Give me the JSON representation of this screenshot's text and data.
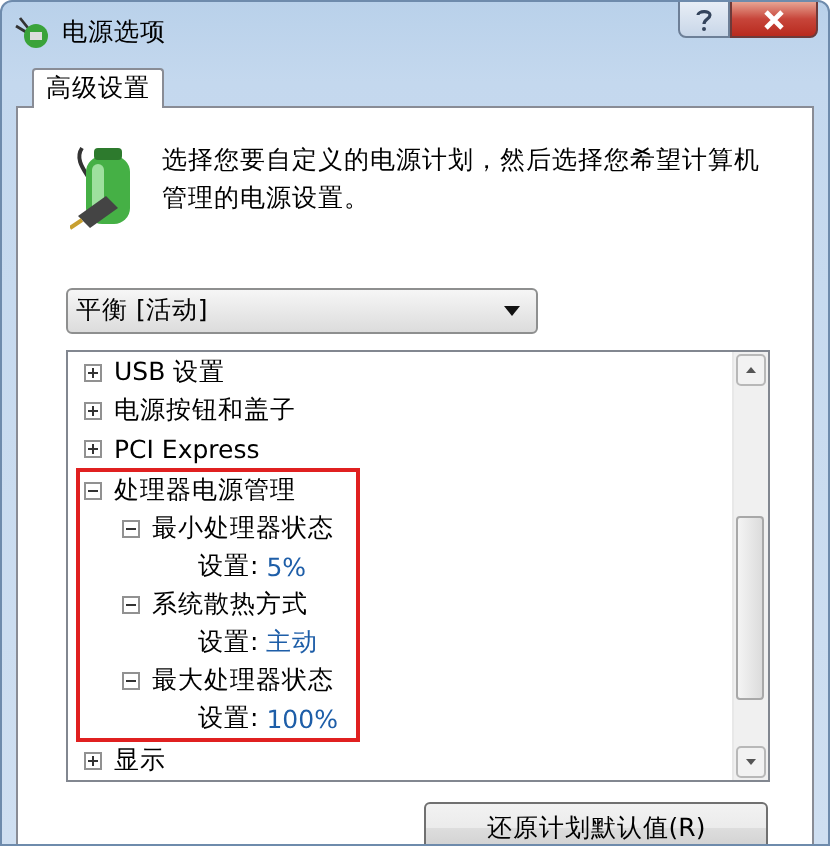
{
  "window": {
    "title": "电源选项"
  },
  "tabs": [
    {
      "label": "高级设置",
      "selected": true
    }
  ],
  "description": "选择您要自定义的电源计划，然后选择您希望计算机管理的电源设置。",
  "plan_dropdown": {
    "value": "平衡 [活动]"
  },
  "settings_tree": [
    {
      "label": "USB 设置",
      "expanded": false
    },
    {
      "label": "电源按钮和盖子",
      "expanded": false
    },
    {
      "label": "PCI Express",
      "expanded": false
    },
    {
      "label": "处理器电源管理",
      "expanded": true,
      "highlighted": true,
      "children": [
        {
          "label": "最小处理器状态",
          "expanded": true,
          "setting": {
            "label": "设置:",
            "value": "5%"
          }
        },
        {
          "label": "系统散热方式",
          "expanded": true,
          "setting": {
            "label": "设置:",
            "value": "主动"
          }
        },
        {
          "label": "最大处理器状态",
          "expanded": true,
          "setting": {
            "label": "设置:",
            "value": "100%"
          }
        }
      ]
    },
    {
      "label": "显示",
      "expanded": false
    }
  ],
  "buttons": [
    "还原计划默认值(R)"
  ]
}
